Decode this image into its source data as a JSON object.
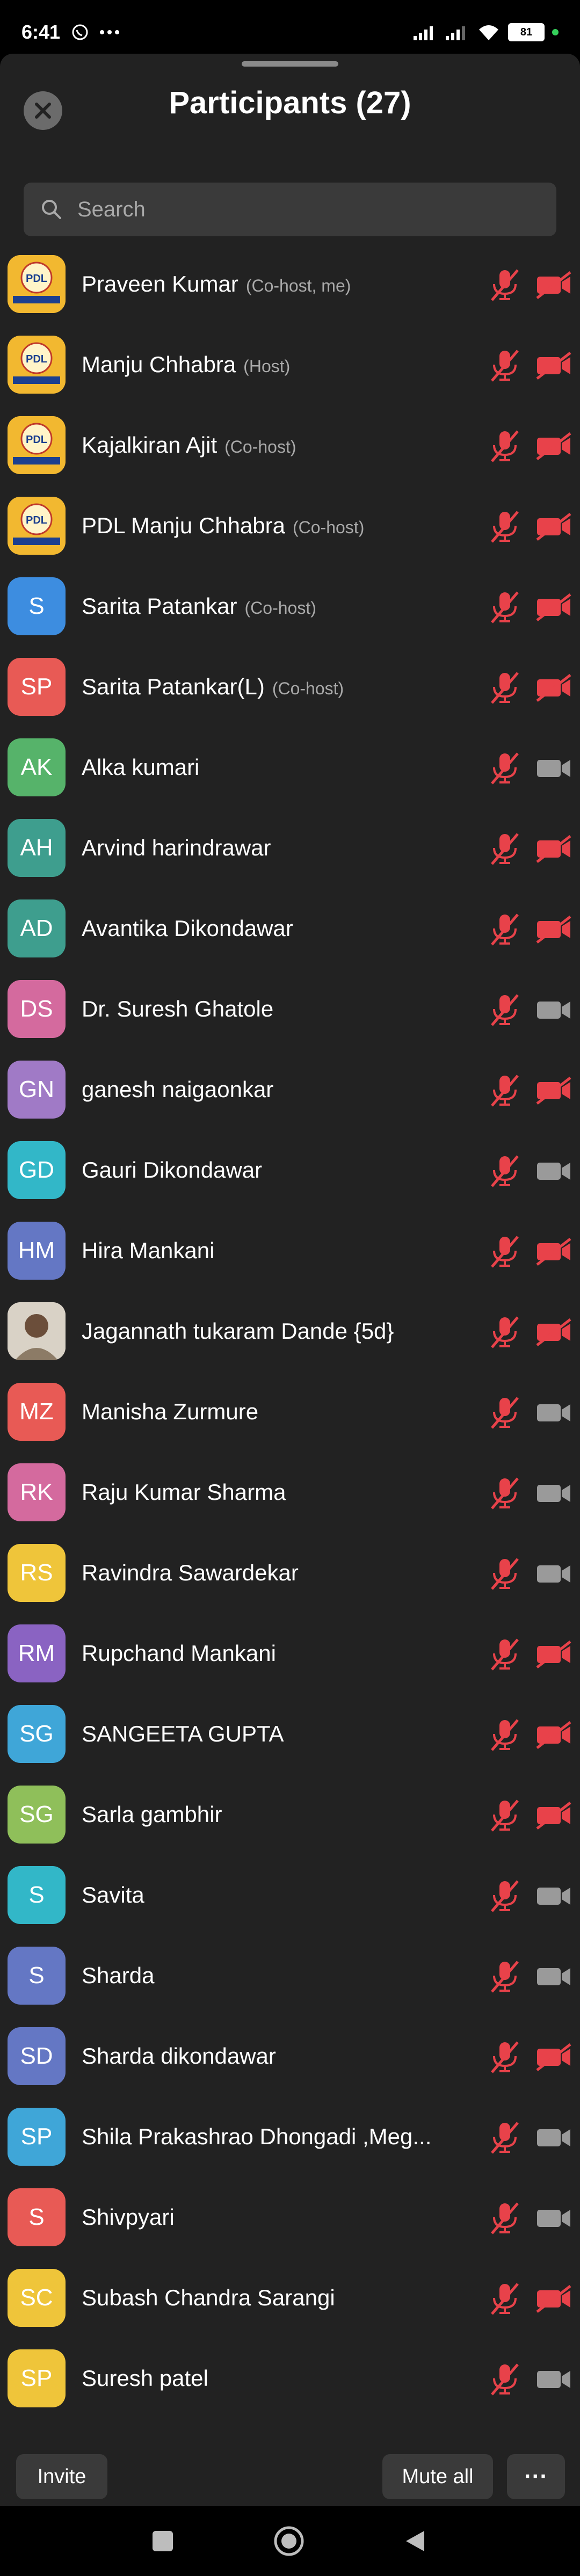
{
  "status": {
    "time": "6:41",
    "battery": "81",
    "icons": [
      "whatsapp-icon",
      "more-dots-icon",
      "signal-icon",
      "signal-icon",
      "wifi-icon",
      "battery-icon"
    ]
  },
  "header": {
    "title": "Participants (27)",
    "close_icon": "close-icon"
  },
  "search": {
    "placeholder": "Search"
  },
  "participants": [
    {
      "initials": "PDL",
      "name": "Praveen Kumar",
      "role": "(Co-host, me)",
      "avatar": "logo",
      "color": "#d8a22a",
      "mic": "muted",
      "cam": "off"
    },
    {
      "initials": "PDL",
      "name": "Manju Chhabra",
      "role": "(Host)",
      "avatar": "logo",
      "color": "#d8a22a",
      "mic": "muted",
      "cam": "off"
    },
    {
      "initials": "PDL",
      "name": "Kajalkiran Ajit",
      "role": "(Co-host)",
      "avatar": "logo",
      "color": "#d8a22a",
      "mic": "muted",
      "cam": "off"
    },
    {
      "initials": "PDL",
      "name": "PDL Manju Chhabra",
      "role": "(Co-host)",
      "avatar": "logo",
      "color": "#d8a22a",
      "mic": "muted",
      "cam": "off"
    },
    {
      "initials": "S",
      "name": "Sarita  Patankar",
      "role": "(Co-host)",
      "color": "#3d8de0",
      "mic": "muted",
      "cam": "off"
    },
    {
      "initials": "SP",
      "name": "Sarita Patankar(L)",
      "role": "(Co-host)",
      "color": "#e85a55",
      "mic": "muted",
      "cam": "off"
    },
    {
      "initials": "AK",
      "name": "Alka kumari",
      "role": "",
      "color": "#56b36a",
      "mic": "muted",
      "cam": "idle"
    },
    {
      "initials": "AH",
      "name": "Arvind harindrawar",
      "role": "",
      "color": "#3e9e8e",
      "mic": "muted",
      "cam": "off"
    },
    {
      "initials": "AD",
      "name": "Avantika Dikondawar",
      "role": "",
      "color": "#3e9e8e",
      "mic": "muted",
      "cam": "off"
    },
    {
      "initials": "DS",
      "name": "Dr. Suresh  Ghatole",
      "role": "",
      "color": "#d46a9e",
      "mic": "muted",
      "cam": "idle"
    },
    {
      "initials": "GN",
      "name": "ganesh naigaonkar",
      "role": "",
      "color": "#a07ac6",
      "mic": "muted",
      "cam": "off"
    },
    {
      "initials": "GD",
      "name": "Gauri Dikondawar",
      "role": "",
      "color": "#32b7c8",
      "mic": "muted",
      "cam": "idle"
    },
    {
      "initials": "HM",
      "name": "Hira Mankani",
      "role": "",
      "color": "#6477c4",
      "mic": "muted",
      "cam": "off"
    },
    {
      "initials": "",
      "name": "Jagannath tukaram Dande {5d}",
      "role": "",
      "avatar": "photo",
      "color": "#7a6a58",
      "mic": "muted",
      "cam": "off"
    },
    {
      "initials": "MZ",
      "name": "Manisha Zurmure",
      "role": "",
      "color": "#e85a55",
      "mic": "muted",
      "cam": "idle"
    },
    {
      "initials": "RK",
      "name": "Raju Kumar Sharma",
      "role": "",
      "color": "#d46a9e",
      "mic": "muted",
      "cam": "idle"
    },
    {
      "initials": "RS",
      "name": "Ravindra Sawardekar",
      "role": "",
      "color": "#efc53a",
      "mic": "muted",
      "cam": "idle"
    },
    {
      "initials": "RM",
      "name": "Rupchand Mankani",
      "role": "",
      "color": "#8a63c2",
      "mic": "muted",
      "cam": "off"
    },
    {
      "initials": "SG",
      "name": "SANGEETA GUPTA",
      "role": "",
      "color": "#3fa6d8",
      "mic": "muted",
      "cam": "off"
    },
    {
      "initials": "SG",
      "name": "Sarla gambhir",
      "role": "",
      "color": "#8fbf5a",
      "mic": "muted",
      "cam": "off"
    },
    {
      "initials": "S",
      "name": "Savita",
      "role": "",
      "color": "#32b7c8",
      "mic": "muted",
      "cam": "idle"
    },
    {
      "initials": "S",
      "name": "Sharda",
      "role": "",
      "color": "#6477c4",
      "mic": "muted",
      "cam": "idle"
    },
    {
      "initials": "SD",
      "name": "Sharda dikondawar",
      "role": "",
      "color": "#6477c4",
      "mic": "muted",
      "cam": "off"
    },
    {
      "initials": "SP",
      "name": "Shila Prakashrao Dhongadi ,Meg...",
      "role": "",
      "color": "#3fa6d8",
      "mic": "muted",
      "cam": "idle"
    },
    {
      "initials": "S",
      "name": "Shivpyari",
      "role": "",
      "color": "#e85a55",
      "mic": "muted",
      "cam": "idle"
    },
    {
      "initials": "SC",
      "name": "Subash Chandra Sarangi",
      "role": "",
      "color": "#efc53a",
      "mic": "muted",
      "cam": "off"
    },
    {
      "initials": "SP",
      "name": "Suresh patel",
      "role": "",
      "color": "#efc53a",
      "mic": "muted",
      "cam": "idle"
    }
  ],
  "footer": {
    "invite": "Invite",
    "mute_all": "Mute all",
    "more": "···"
  },
  "colors": {
    "sheet_bg": "#222222",
    "muted_red": "#e8424a",
    "idle_gray": "#9a9a9a"
  }
}
